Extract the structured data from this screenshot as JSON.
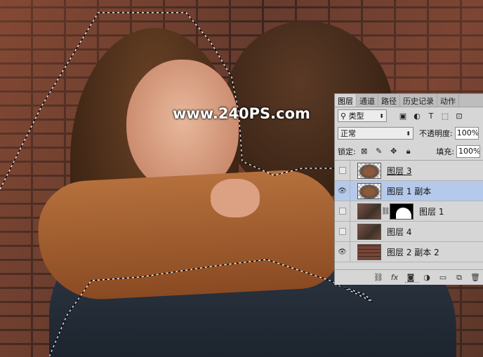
{
  "watermark": "www.240PS.com",
  "panel": {
    "tabs": [
      "图层",
      "通道",
      "路径",
      "历史记录",
      "动作"
    ],
    "filter": {
      "value": "类型"
    },
    "filter_icons": [
      "image-filter-icon",
      "adjustment-filter-icon",
      "type-filter-icon",
      "shape-filter-icon",
      "smart-object-filter-icon"
    ],
    "blend_mode": "正常",
    "opacity_label": "不透明度:",
    "opacity_value": "100%",
    "lock_label": "锁定:",
    "fill_label": "填充:",
    "fill_value": "100%",
    "layers": [
      {
        "name": "图层 3",
        "visible": false,
        "selected": false,
        "thumb": "cutout",
        "mask": false
      },
      {
        "name": "图层 1 副本",
        "visible": true,
        "selected": true,
        "thumb": "cutout",
        "mask": false
      },
      {
        "name": "图层 1",
        "visible": false,
        "selected": false,
        "thumb": "photo",
        "mask": true
      },
      {
        "name": "图层 4",
        "visible": false,
        "selected": false,
        "thumb": "photo",
        "mask": false
      },
      {
        "name": "图层 2 副本 2",
        "visible": true,
        "selected": false,
        "thumb": "brick",
        "mask": false
      }
    ]
  },
  "colors": {
    "selected_row": "#b5c9ea",
    "panel_bg": "#d6d6d6"
  }
}
